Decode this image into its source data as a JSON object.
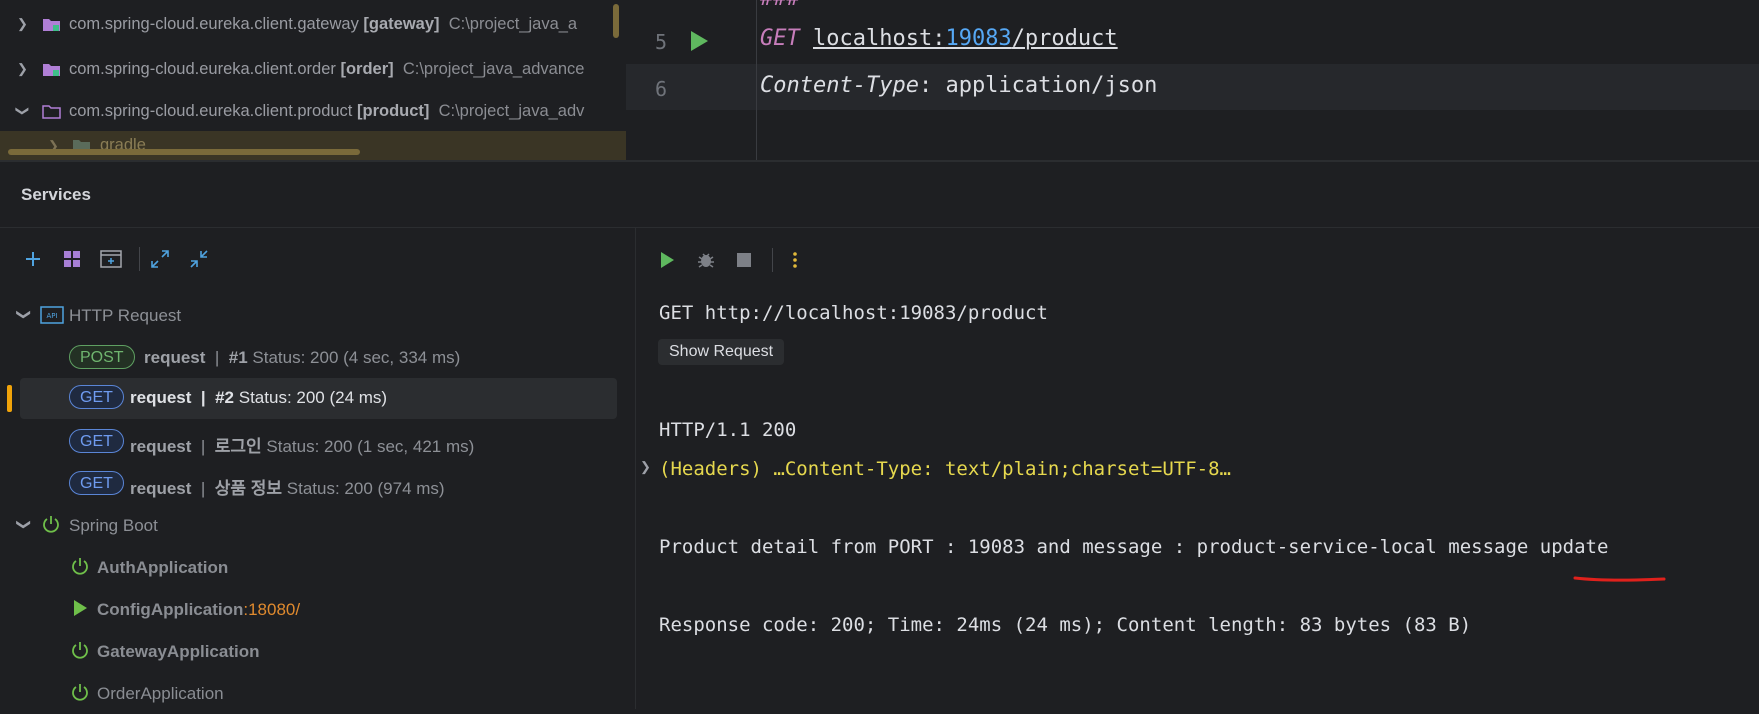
{
  "project_tree": {
    "rows": [
      {
        "name": "com.spring-cloud.eureka.client.gateway",
        "module": "[gateway]",
        "path": "C:\\project_java_a"
      },
      {
        "name": "com.spring-cloud.eureka.client.order",
        "module": "[order]",
        "path": "C:\\project_java_advance"
      },
      {
        "name": "com.spring-cloud.eureka.client.product",
        "module": "[product]",
        "path": "C:\\project_java_adv"
      }
    ],
    "gradle_label": "gradle"
  },
  "editor": {
    "line5_number": "5",
    "line6_number": "6",
    "line4_fragment": "###",
    "method": "GET",
    "url_host": "localhost:",
    "url_port": "19083",
    "url_path": "/product",
    "header_name": "Content-Type",
    "header_sep": ":",
    "header_value": " application/json"
  },
  "services": {
    "title": "Services",
    "tree": {
      "http_group": "HTTP Request",
      "requests": [
        {
          "method": "POST",
          "name": "request",
          "sep": "|",
          "id": "#1",
          "status": "Status: 200 (4 sec, 334 ms)"
        },
        {
          "method": "GET",
          "name": "request",
          "sep": "|",
          "id": "#2",
          "status": "Status: 200 (24 ms)"
        },
        {
          "method": "GET",
          "name": "request",
          "sep": "|",
          "id": "로그인",
          "status": "Status: 200 (1 sec, 421 ms)"
        },
        {
          "method": "GET",
          "name": "request",
          "sep": "|",
          "id": "상품 정보",
          "status": "Status: 200 (974 ms)"
        }
      ],
      "spring_group": "Spring Boot",
      "apps": [
        {
          "name": "AuthApplication",
          "port": ""
        },
        {
          "name": "ConfigApplication",
          "port": ":18080/"
        },
        {
          "name": "GatewayApplication",
          "port": ""
        },
        {
          "name": "OrderApplication",
          "port": ""
        }
      ]
    },
    "response": {
      "request_line": "GET http://localhost:19083/product",
      "show_request": "Show Request",
      "status_line": "HTTP/1.1 200",
      "headers_line": "(Headers) …Content-Type: text/plain;charset=UTF-8…",
      "body": "Product detail from PORT : 19083 and message : product-service-local message update",
      "summary": "Response code: 200; Time: 24ms (24 ms); Content length: 83 bytes (83 B)"
    }
  },
  "colors": {
    "background": "#1e1f22",
    "run_green": "#5fb85f",
    "selection_marker": "#f0a30a",
    "annotation_red": "#e0211c",
    "port_blue": "#56a8f5",
    "keyword_purple": "#c77dbb"
  }
}
